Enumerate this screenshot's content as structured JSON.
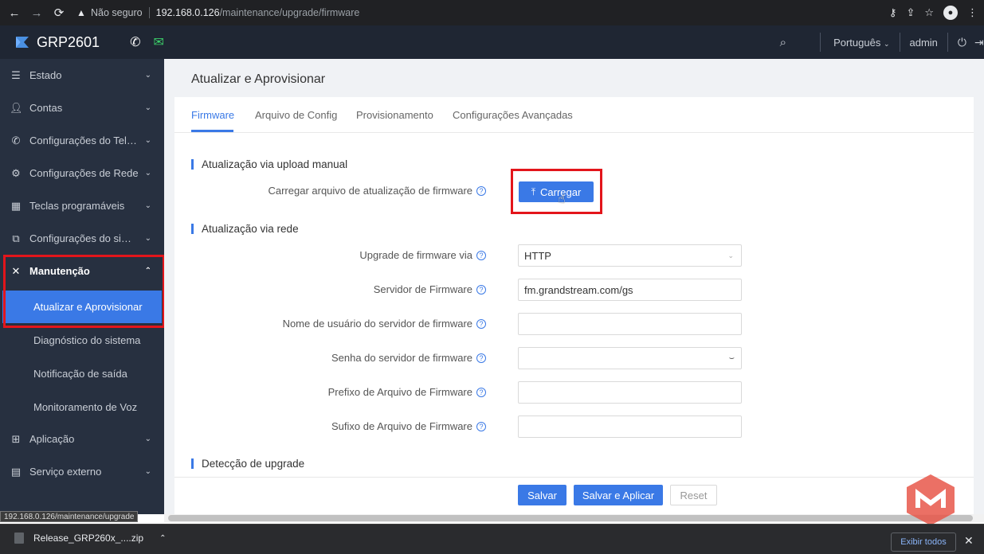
{
  "browser": {
    "insecure_label": "Não seguro",
    "url_host": "192.168.0.126",
    "url_path": "/maintenance/upgrade/firmware",
    "status_url": "192.168.0.126/maintenance/upgrade"
  },
  "header": {
    "brand": "GRP2601",
    "language": "Português",
    "user": "admin"
  },
  "sidebar": {
    "items": [
      {
        "label": "Estado",
        "icon": "list-icon"
      },
      {
        "label": "Contas",
        "icon": "user-icon"
      },
      {
        "label": "Configurações do Telefone",
        "icon": "phone-icon"
      },
      {
        "label": "Configurações de Rede",
        "icon": "network-icon"
      },
      {
        "label": "Teclas programáveis",
        "icon": "keypad-icon"
      },
      {
        "label": "Configurações do sistema",
        "icon": "system-settings-icon"
      },
      {
        "label": "Manutenção",
        "icon": "tools-icon"
      },
      {
        "label": "Aplicação",
        "icon": "apps-icon"
      },
      {
        "label": "Serviço externo",
        "icon": "document-icon"
      }
    ],
    "sub_items": [
      {
        "label": "Atualizar e Aprovisionar"
      },
      {
        "label": "Diagnóstico do sistema"
      },
      {
        "label": "Notificação de saída"
      },
      {
        "label": "Monitoramento de Voz"
      }
    ]
  },
  "main": {
    "page_title": "Atualizar e Aprovisionar",
    "tabs": [
      {
        "label": "Firmware"
      },
      {
        "label": "Arquivo de Config"
      },
      {
        "label": "Provisionamento"
      },
      {
        "label": "Configurações Avançadas"
      }
    ],
    "section_manual": "Atualização via upload manual",
    "upload_label": "Carregar arquivo de atualização de firmware",
    "upload_button": "Carregar",
    "section_network": "Atualização via rede",
    "fields": [
      {
        "label": "Upgrade de firmware via",
        "value": "HTTP"
      },
      {
        "label": "Servidor de Firmware",
        "value": "fm.grandstream.com/gs"
      },
      {
        "label": "Nome de usuário do servidor de firmware",
        "value": ""
      },
      {
        "label": "Senha do servidor de firmware",
        "value": ""
      },
      {
        "label": "Prefixo de Arquivo de Firmware",
        "value": ""
      },
      {
        "label": "Sufixo de Arquivo de Firmware",
        "value": ""
      }
    ],
    "section_detect": "Detecção de upgrade"
  },
  "footer": {
    "save": "Salvar",
    "save_apply": "Salvar e Aplicar",
    "reset": "Reset"
  },
  "downloads": {
    "file_name": "Release_GRP260x_....zip",
    "show_all": "Exibir todos"
  },
  "colors": {
    "accent": "#3a79e6",
    "sidebar_bg": "#273040",
    "highlight_box": "#e3151b"
  }
}
